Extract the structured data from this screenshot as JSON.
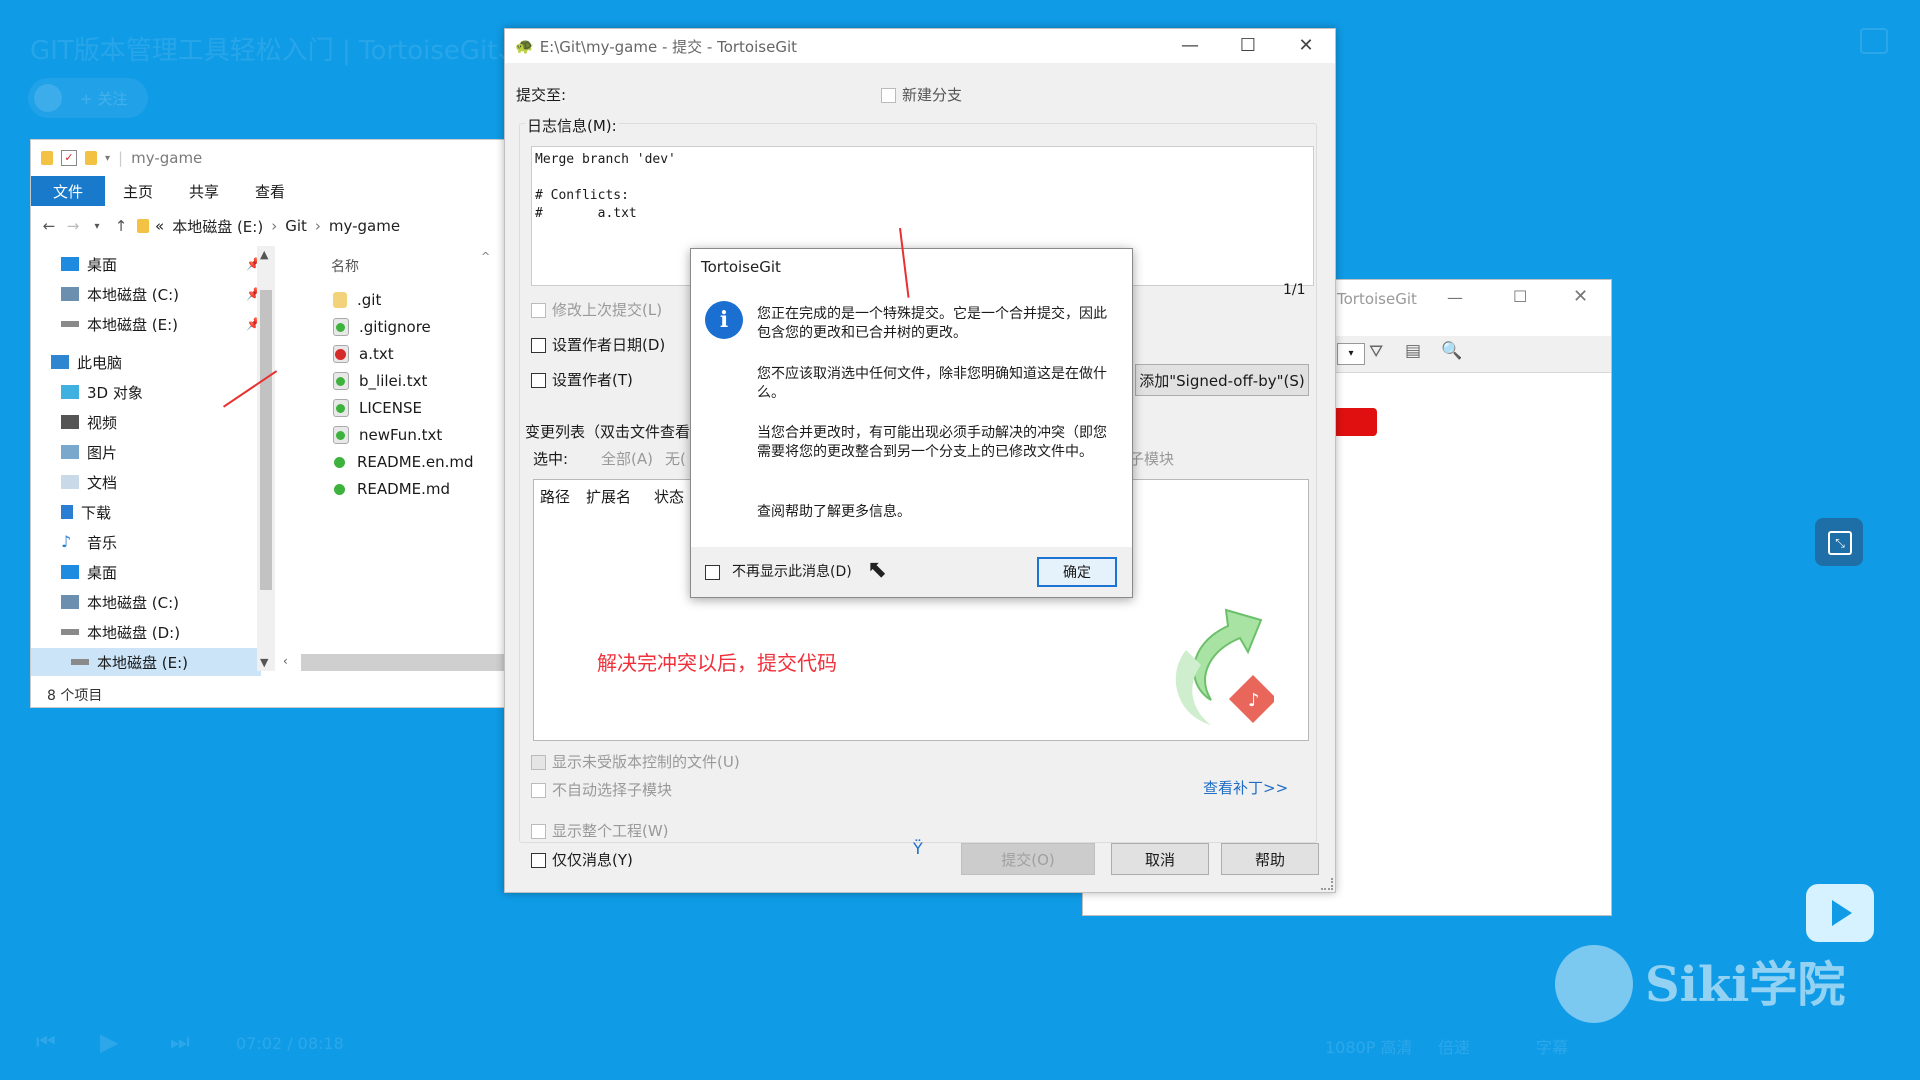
{
  "video": {
    "title": "GIT版本管理工具轻松入门 | TortoiseGit、GitLab、GitHub、Gitee（含详细笔记",
    "follow": "+ 关注",
    "time": "07:02 / 08:18",
    "quality": "1080P 高清",
    "speed": "倍速",
    "subtitle": "字幕",
    "logo": "Siki学院"
  },
  "explorer": {
    "title": "my-game",
    "tabs": [
      "文件",
      "主页",
      "共享",
      "查看"
    ],
    "breadcrumb": [
      "本地磁盘 (E:)",
      "Git",
      "my-game"
    ],
    "nav": [
      {
        "label": "桌面",
        "pin": true
      },
      {
        "label": "本地磁盘 (C:)",
        "pin": true
      },
      {
        "label": "本地磁盘 (E:)",
        "pin": true
      },
      {
        "label": "此电脑"
      },
      {
        "label": "3D 对象"
      },
      {
        "label": "视频"
      },
      {
        "label": "图片"
      },
      {
        "label": "文档"
      },
      {
        "label": "下载"
      },
      {
        "label": "音乐"
      },
      {
        "label": "桌面"
      },
      {
        "label": "本地磁盘 (C:)"
      },
      {
        "label": "本地磁盘 (D:)"
      },
      {
        "label": "本地磁盘 (E:)"
      }
    ],
    "column_name": "名称",
    "files": [
      ".git",
      ".gitignore",
      "a.txt",
      "b_lilei.txt",
      "LICENSE",
      "newFun.txt",
      "README.en.md",
      "README.md"
    ],
    "status": "8 个项目"
  },
  "commit": {
    "title": "E:\\Git\\my-game - 提交 - TortoiseGit",
    "commit_to": "提交至:",
    "new_branch": "新建分支",
    "log_label": "日志信息(M):",
    "message": "Merge branch 'dev'\n\n# Conflicts:\n#       a.txt",
    "counter": "1/1",
    "amend": "修改上次提交(L)",
    "set_date": "设置作者日期(D)",
    "set_author": "设置作者(T)",
    "signed_off": "添加\"Signed-off-by\"(S)",
    "changes_label": "变更列表（双击文件查看",
    "select_label": "选中:",
    "select_all": "全部(A)",
    "select_none": "无(",
    "submodule": "子模块",
    "cols": [
      "路径",
      "扩展名",
      "状态"
    ],
    "note": "解决完冲突以后，提交代码",
    "show_unversioned": "显示未受版本控制的文件(U)",
    "no_auto_submodule": "不自动选择子模块",
    "view_patch": "查看补丁>>",
    "show_whole": "显示整个工程(W)",
    "only_msg": "仅仅消息(Y)",
    "btn_commit": "提交(O)",
    "btn_cancel": "取消",
    "btn_help": "帮助"
  },
  "back": {
    "title": "TortoiseGit"
  },
  "msgbox": {
    "title": "TortoiseGit",
    "p1": "您正在完成的是一个特殊提交。它是一个合并提交，因此包含您的更改和已合并树的更改。",
    "p2": "您不应该取消选中任何文件，除非您明确知道这是在做什么。",
    "p3": "当您合并更改时，有可能出现必须手动解决的冲突（即您需要将您的更改整合到另一个分支上的已修改文件中。",
    "p4": "查阅帮助了解更多信息。",
    "dont_show": "不再显示此消息(D)",
    "ok": "确定"
  },
  "colors": {
    "bg": "#0f9be6",
    "accent": "#1979ca",
    "note": "#f0303a"
  }
}
